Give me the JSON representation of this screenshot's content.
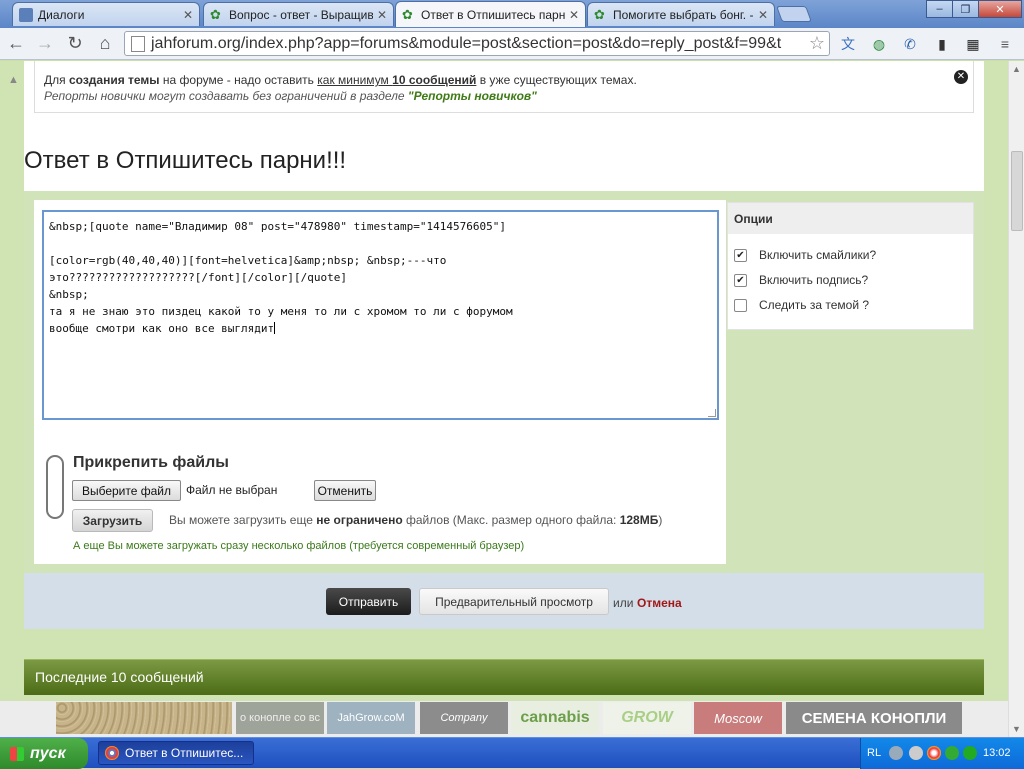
{
  "browser": {
    "tabs": [
      {
        "title": "Диалоги",
        "active": false
      },
      {
        "title": "Вопрос - ответ - Выращива",
        "active": false
      },
      {
        "title": "Ответ в Отпишитесь парни",
        "active": true
      },
      {
        "title": "Помогите выбрать бонг. - Б",
        "active": false
      }
    ],
    "url": "jahforum.org/index.php?app=forums&module=post&section=post&do=reply_post&f=99&t",
    "window_controls": {
      "minimize": "‒",
      "restore": "❐",
      "close": "✕"
    }
  },
  "notice": {
    "pre": "Для ",
    "bold1": "создания темы",
    "mid1": " на форуме - надо оставить ",
    "u1": "как минимум ",
    "bold2": "10 сообщений",
    "mid2": " в уже существующих темах.",
    "line2_pre": "Репорты новички могут создавать без ограничений в разделе ",
    "line2_link": "\"Репорты новичков\""
  },
  "page_title": "Ответ в Отпишитесь парни!!!",
  "editor": {
    "line1": "&nbsp;[quote name=\"Владимир 08\" post=\"478980\" timestamp=\"1414576605\"]",
    "line2": "",
    "line3": "[color=rgb(40,40,40)][font=helvetica]&amp;nbsp; &nbsp;---что",
    "line4": "это???????????????????[/font][/color][/quote]",
    "line5": "&nbsp;",
    "line6": "та я не знаю это пиздец какой то у меня то ли с хромом то ли с форумом",
    "line7": "вообще смотри как оно все выглядит"
  },
  "options": {
    "title": "Опции",
    "items": [
      {
        "label": "Включить смайлики?",
        "checked": true
      },
      {
        "label": "Включить подпись?",
        "checked": true
      },
      {
        "label": "Следить за темой ?",
        "checked": false
      }
    ]
  },
  "attach": {
    "title": "Прикрепить файлы",
    "choose_label": "Выберите файл",
    "no_file": "Файл не выбран",
    "cancel_label": "Отменить",
    "upload_label": "Загрузить",
    "info_pre": "Вы можете загрузить еще ",
    "info_bold": "не ограничено",
    "info_mid": " файлов (Макс. размер одного файла: ",
    "info_size": "128МБ",
    "info_post": ")",
    "multi_note": "А еще Вы можете загружать сразу несколько файлов (требуется современный браузер)"
  },
  "submit": {
    "send_label": "Отправить",
    "preview_label": "Предварительный просмотр",
    "or_label": "или",
    "cancel_label": "Отмена"
  },
  "last_posts_title": "Последние 10 сообщений",
  "banners": [
    {
      "text": ""
    },
    {
      "text": "о конопле со вс"
    },
    {
      "text": "JahGrow.coM"
    },
    {
      "text": "Company"
    },
    {
      "text": "cannabis"
    },
    {
      "text": "GROW"
    },
    {
      "text": "Moscow"
    },
    {
      "text": "СЕМЕНА КОНОПЛИ"
    }
  ],
  "taskbar": {
    "start_label": "пуск",
    "window_label": "Ответ в Отпишитес...",
    "lang": "RL",
    "clock": "13:02"
  },
  "colors": {
    "page_green": "#cfe3b3",
    "bar_green": "#4c6b16",
    "cancel_red": "#a01818",
    "note_green": "#3a7a1a"
  }
}
